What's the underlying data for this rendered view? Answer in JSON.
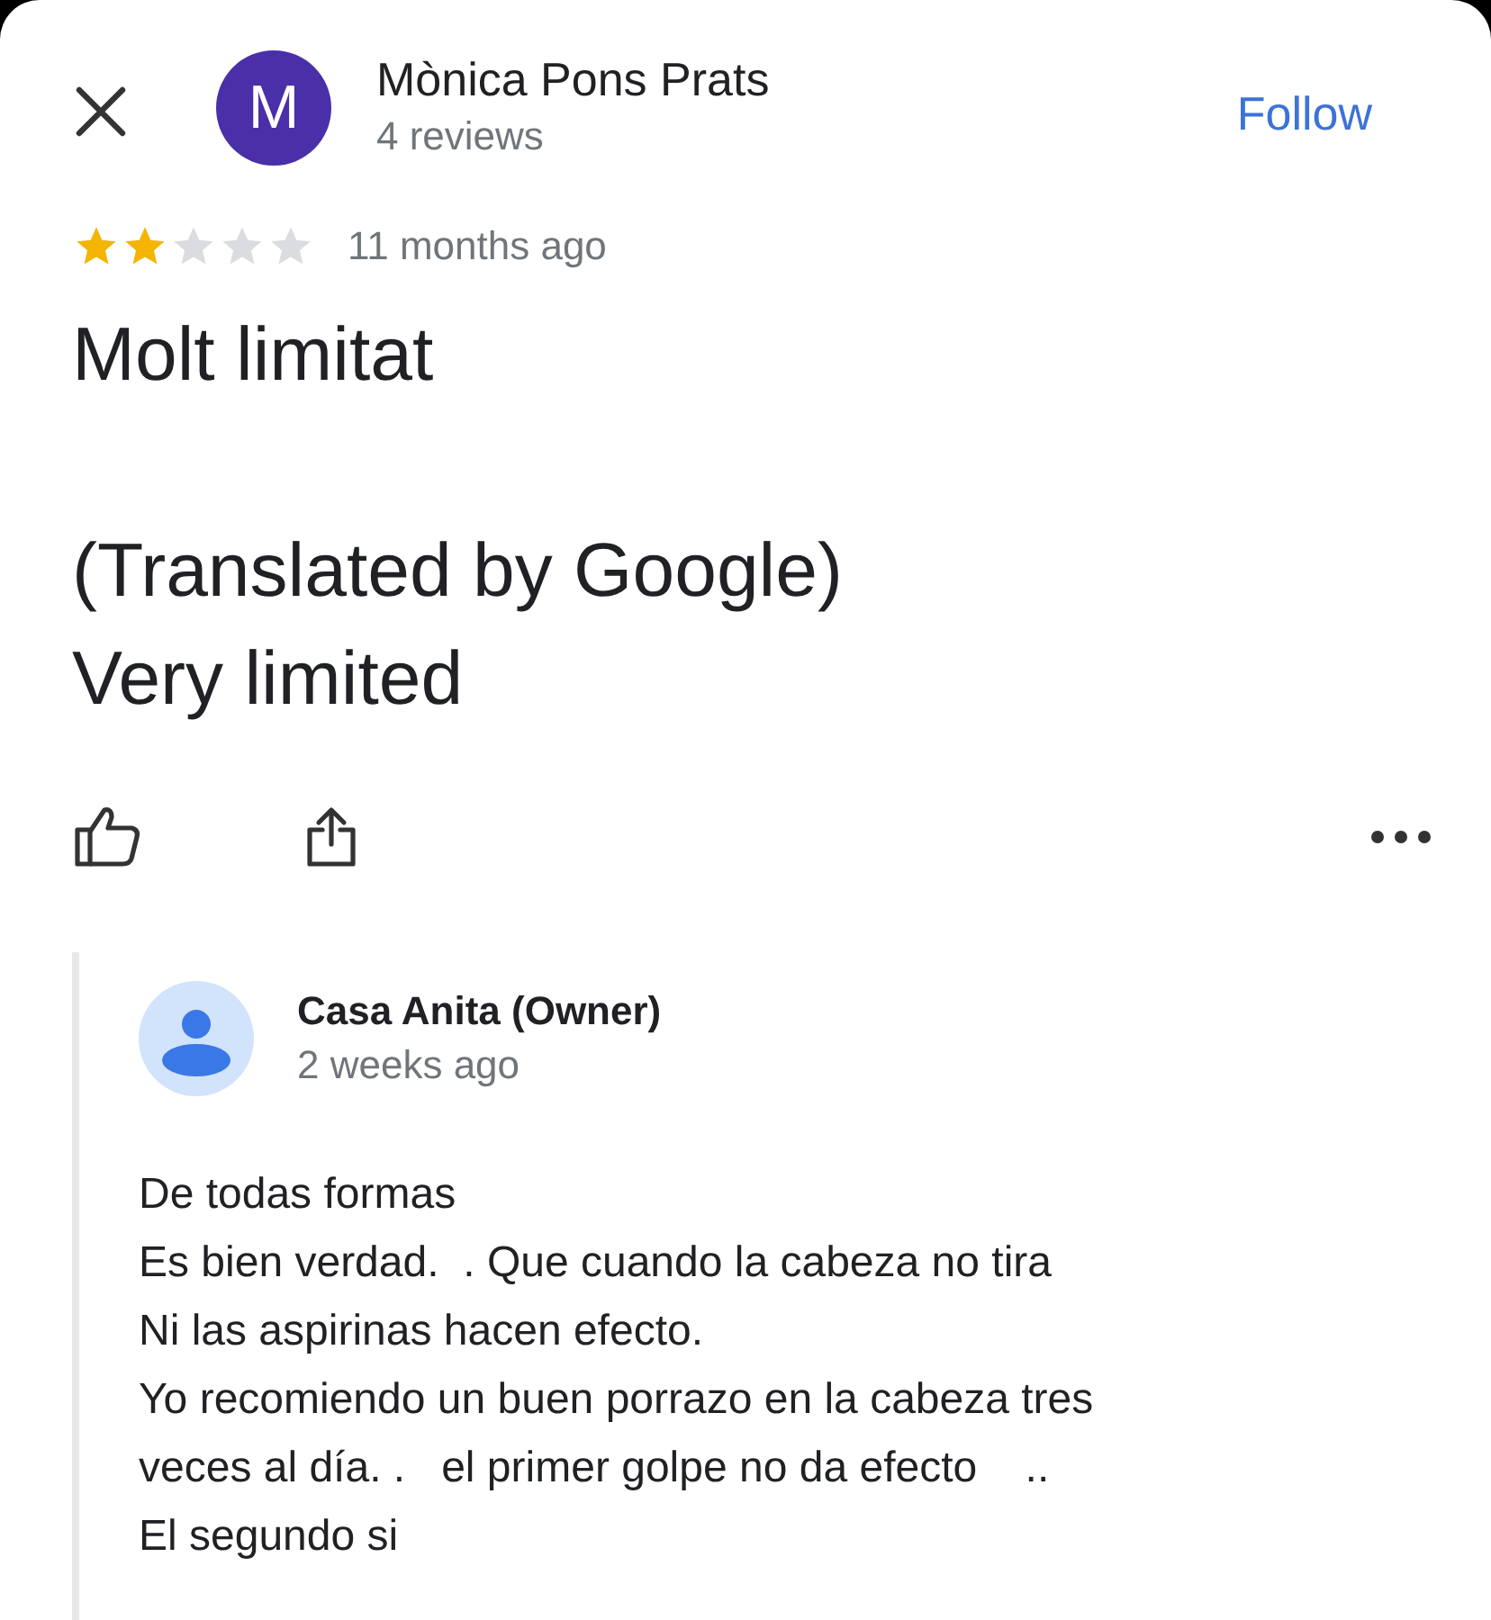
{
  "reviewer": {
    "initial": "M",
    "name": "Mònica Pons Prats",
    "review_count": "4 reviews"
  },
  "follow_button": "Follow",
  "review": {
    "stars": 2,
    "time": "11 months ago",
    "text": "Molt limitat\n\n(Translated by Google)\nVery limited"
  },
  "reply": {
    "name": "Casa Anita (Owner)",
    "time": "2 weeks ago",
    "text": "De todas formas\nEs bien verdad.  . Que cuando la cabeza no tira\nNi las aspirinas hacen efecto.\nYo recomiendo un buen porrazo en la cabeza tres\nveces al día. .   el primer golpe no da efecto    ..\nEl segundo si"
  }
}
